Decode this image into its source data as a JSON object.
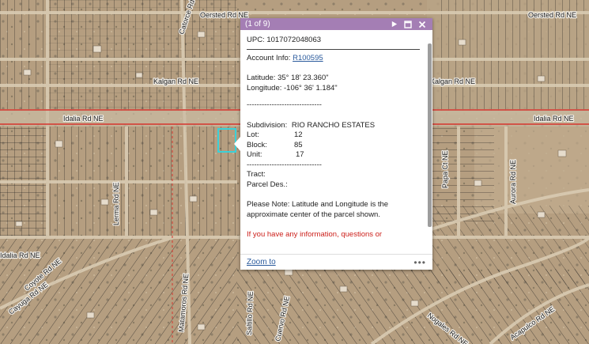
{
  "map": {
    "road_labels": [
      "Oersted Rd NE",
      "Oersted Rd NE",
      "Kalgan Rd NE",
      "Kalgan Rd NE",
      "Idalia Rd NE",
      "Idalia Rd NE",
      "Lerma Rd NE",
      "Papa Ct NE",
      "Aurora Rd NE",
      "Idalia Rd NE",
      "Cayuga Rd NE",
      "Coyote Rd NE",
      "Matamoros Rd NE",
      "Saltillo Rd NE",
      "Catorce Rd NE",
      "Cuervo Rd NE",
      "Nogales Rd NE",
      "Acapulco Rd NE"
    ]
  },
  "popup": {
    "count": "(1 of 9)",
    "upc": "UPC: 1017072048063",
    "account_label": "Account Info: ",
    "account_link": "R100595",
    "latitude": "Latitude: 35° 18' 23.360\"",
    "longitude": "Longitude: -106° 36' 1.184\"",
    "divider": "------------------------------",
    "subdivision_label": "Subdivision:",
    "subdivision_value": "RIO RANCHO ESTATES",
    "lot_label": "Lot:",
    "lot_value": "12",
    "block_label": "Block:",
    "block_value": "85",
    "unit_label": "Unit:",
    "unit_value": "17",
    "tract_label": "Tract:",
    "parcel_label": "Parcel Des.:",
    "note": "Please Note: Latitude and Longitude is the approximate center of the parcel shown.",
    "red_note": "If you have any information, questions or",
    "zoom_to": "Zoom to",
    "more": "•••"
  },
  "colors": {
    "header": "#a47eb4",
    "selection": "#3ad0d8",
    "road_red": "#d5352e",
    "link": "#2a5a9c"
  }
}
